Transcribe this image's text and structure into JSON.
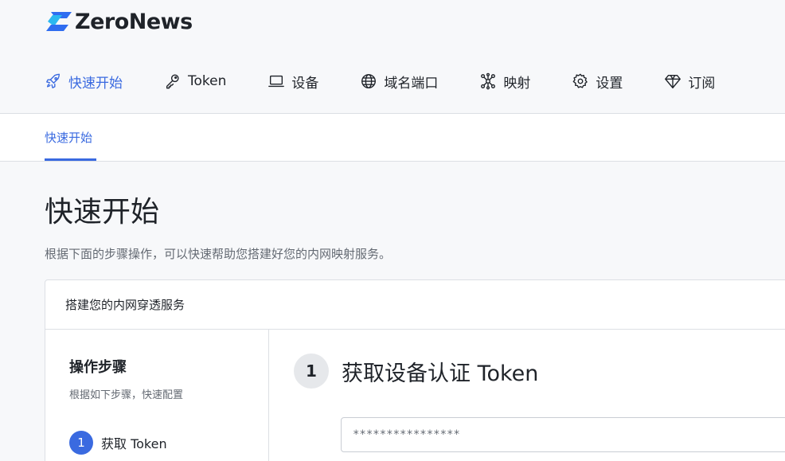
{
  "brand": {
    "name": "ZeroNews",
    "accent": "#3a6ae0"
  },
  "nav": {
    "items": [
      {
        "label": "快速开始",
        "icon": "rocket-icon",
        "active": true
      },
      {
        "label": "Token",
        "icon": "key-icon"
      },
      {
        "label": "设备",
        "icon": "laptop-icon"
      },
      {
        "label": "域名端口",
        "icon": "globe-icon"
      },
      {
        "label": "映射",
        "icon": "network-icon"
      },
      {
        "label": "设置",
        "icon": "gear-icon"
      },
      {
        "label": "订阅",
        "icon": "diamond-icon"
      }
    ]
  },
  "tabs": {
    "active": "快速开始"
  },
  "page": {
    "title": "快速开始",
    "description": "根据下面的步骤操作，可以快速帮助您搭建好您的内网映射服务。"
  },
  "card": {
    "title": "搭建您的内网穿透服务",
    "steps_panel": {
      "title": "操作步骤",
      "subtitle": "根据如下步骤，快速配置",
      "steps": [
        {
          "number": "1",
          "label": "获取 Token"
        }
      ]
    },
    "main": {
      "step_number": "1",
      "step_title": "获取设备认证 Token",
      "token_value": "****************"
    }
  }
}
